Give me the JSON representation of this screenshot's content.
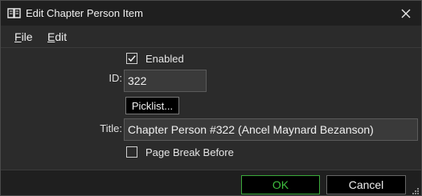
{
  "window": {
    "title": "Edit Chapter Person Item",
    "icons": {
      "app": "book-icon",
      "close": "close-icon",
      "grip": "resize-grip-icon"
    }
  },
  "menu": {
    "items": [
      {
        "mnemonic": "F",
        "rest": "ile"
      },
      {
        "mnemonic": "E",
        "rest": "dit"
      }
    ]
  },
  "form": {
    "enabled": {
      "label": "Enabled",
      "checked": true
    },
    "id": {
      "label": "ID:",
      "value": "322"
    },
    "picklist_label": "Picklist...",
    "title": {
      "label": "Title:",
      "value": "Chapter Person #322 (Ancel Maynard Bezanson)"
    },
    "page_break": {
      "label": "Page Break Before",
      "checked": false
    }
  },
  "buttons": {
    "ok": "OK",
    "cancel": "Cancel"
  },
  "colors": {
    "ok_accent": "#3fbf3f",
    "background": "#2b2b2b",
    "titlebar": "#1f1f1f"
  }
}
